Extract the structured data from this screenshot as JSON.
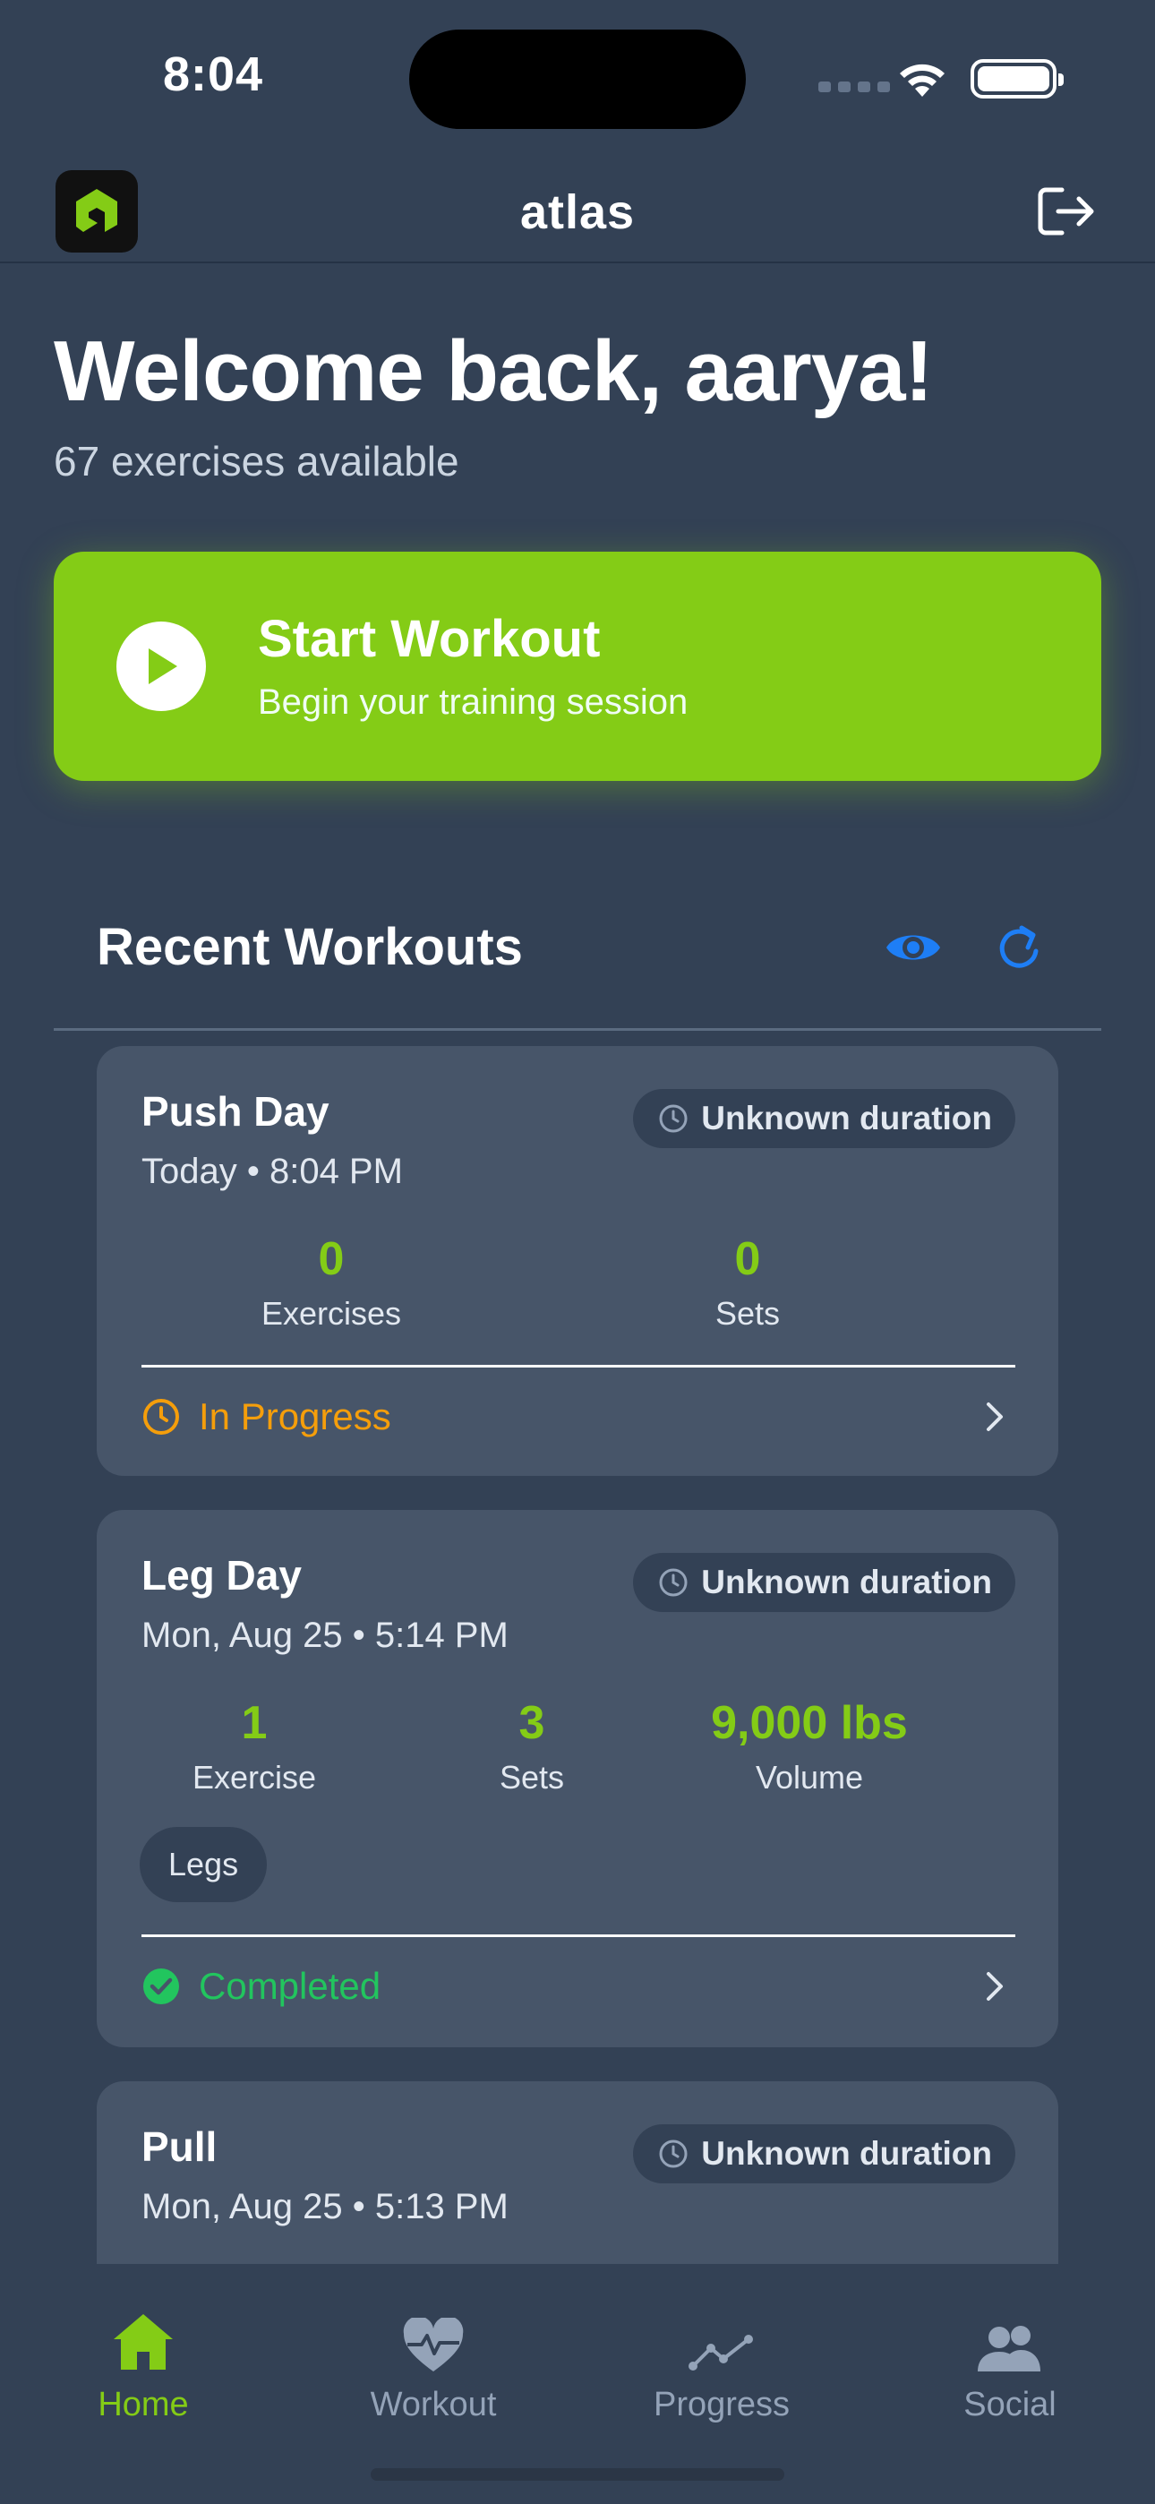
{
  "status_bar": {
    "time": "8:04"
  },
  "header": {
    "title": "atlas",
    "logo_icon": "atlas-logo-icon",
    "logout_icon": "logout-icon"
  },
  "welcome": {
    "title": "Welcome back, aarya!",
    "subtitle": "67 exercises available"
  },
  "start_workout": {
    "title": "Start Workout",
    "subtitle": "Begin your training session",
    "icon": "play-icon",
    "color": "#84cc16"
  },
  "recent": {
    "title": "Recent Workouts",
    "icons": [
      "eye-icon",
      "refresh-icon"
    ],
    "workouts": [
      {
        "name": "Push Day",
        "date": "Today • 8:04 PM",
        "duration": "Unknown duration",
        "stats": [
          {
            "value": "0",
            "label": "Exercises"
          },
          {
            "value": "0",
            "label": "Sets"
          }
        ],
        "status": "In Progress",
        "status_color": "#f59e0b"
      },
      {
        "name": "Leg Day",
        "date": "Mon, Aug 25 • 5:14 PM",
        "duration": "Unknown duration",
        "stats": [
          {
            "value": "1",
            "label": "Exercise"
          },
          {
            "value": "3",
            "label": "Sets"
          },
          {
            "value": "9,000 lbs",
            "label": "Volume"
          }
        ],
        "tags": [
          "Legs"
        ],
        "status": "Completed",
        "status_color": "#22c55e"
      },
      {
        "name": "Pull",
        "date": "Mon, Aug 25 • 5:13 PM",
        "duration": "Unknown duration"
      }
    ]
  },
  "tabs": [
    {
      "label": "Home",
      "icon": "home-icon",
      "active": true
    },
    {
      "label": "Workout",
      "icon": "heart-pulse-icon",
      "active": false
    },
    {
      "label": "Progress",
      "icon": "trend-line-icon",
      "active": false
    },
    {
      "label": "Social",
      "icon": "users-icon",
      "active": false
    }
  ],
  "colors": {
    "background": "#334155",
    "card": "#475569",
    "accent": "#84cc16",
    "link_blue": "#1e7ef5"
  }
}
